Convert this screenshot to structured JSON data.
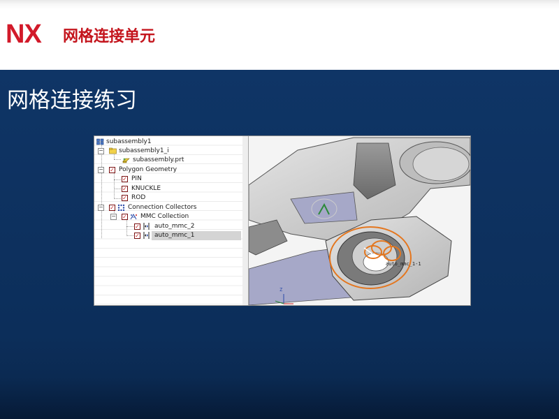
{
  "header": {
    "logo": "NX",
    "title": "网格连接单元"
  },
  "slide": {
    "title": "网格连接练习"
  },
  "navigator": {
    "items": [
      {
        "label": "subassembly1",
        "icon": "assembly-icon"
      },
      {
        "label": "subassembly1_i",
        "icon": "fem-folder-icon"
      },
      {
        "label": "subassembly.prt",
        "icon": "part-icon"
      },
      {
        "label": "Polygon Geometry",
        "icon": "checkbox-icon"
      },
      {
        "label": "PIN",
        "icon": "checkbox-icon"
      },
      {
        "label": "KNUCKLE",
        "icon": "checkbox-icon"
      },
      {
        "label": "ROD",
        "icon": "checkbox-icon"
      },
      {
        "label": "Connection Collectors",
        "icon": "connection-collectors-icon"
      },
      {
        "label": "MMC Collection",
        "icon": "mmc-collection-icon"
      },
      {
        "label": "auto_mmc_2",
        "icon": "mesh-mating-icon"
      },
      {
        "label": "auto_mmc_1",
        "icon": "mesh-mating-icon",
        "selected": true
      }
    ]
  },
  "viewport": {
    "label": "auto_mmc_1-1",
    "axis_z": "Z",
    "colors": {
      "model_gray": "#c8c8c8",
      "model_face_blue": "#a6a8c8",
      "highlight_orange": "#e4761e"
    }
  },
  "theme": {
    "brand_red": "#d21a2a",
    "background_navy": "#0c2e5a"
  }
}
